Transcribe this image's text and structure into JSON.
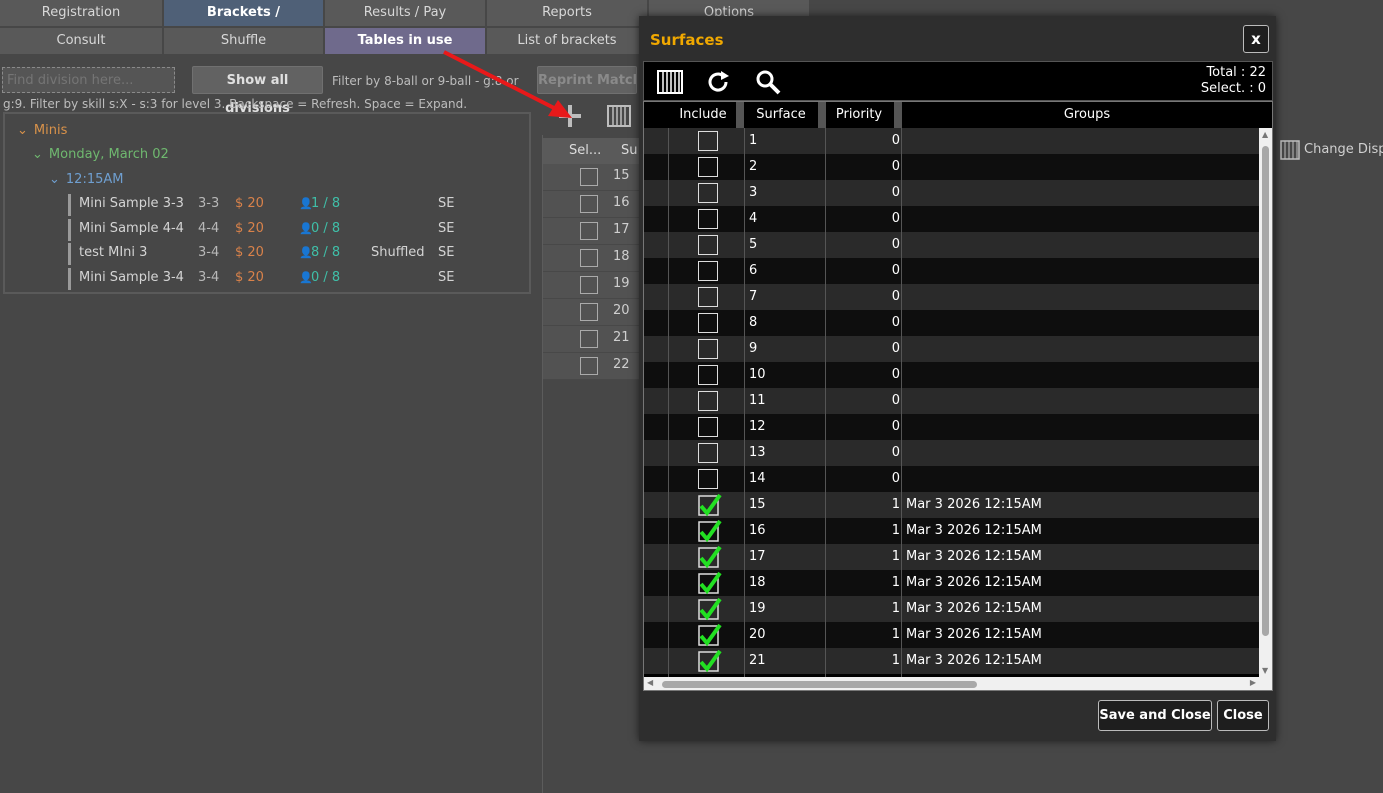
{
  "tabs_row1": [
    "Registration",
    "Brackets /",
    "Results / Pay",
    "Reports",
    "Options"
  ],
  "tabs_row2": [
    "Consult",
    "Shuffle",
    "Tables in use",
    "List of brackets"
  ],
  "filter": {
    "placeholder": "Find division here...",
    "show_all_label": "Show all divisions",
    "hint1": "Filter by 8-ball or 9-ball - g:8 or",
    "hint2": "g:9. Filter by skill s:X - s:3 for level 3. Backspace = Refresh. Space = Expand.",
    "reprint_label": "Reprint Match C"
  },
  "tree": {
    "group": "Minis",
    "date": "Monday, March 02",
    "time": "12:15AM",
    "divisions": [
      {
        "name": "Mini Sample 3-3",
        "level": "3-3",
        "fee": "$ 20",
        "players": "1 / 8",
        "status": "",
        "type": "SE"
      },
      {
        "name": "Mini Sample 4-4",
        "level": "4-4",
        "fee": "$ 20",
        "players": "0 / 8",
        "status": "",
        "type": "SE"
      },
      {
        "name": "test MIni 3",
        "level": "3-4",
        "fee": "$ 20",
        "players": "8 / 8",
        "status": "Shuffled",
        "type": "SE"
      },
      {
        "name": "Mini Sample 3-4",
        "level": "3-4",
        "fee": "$ 20",
        "players": "0 / 8",
        "status": "",
        "type": "SE"
      }
    ]
  },
  "background_table": {
    "headers": [
      "Sel...",
      "Su"
    ],
    "rows": [
      "15",
      "16",
      "17",
      "18",
      "19",
      "20",
      "21",
      "22"
    ]
  },
  "change_display_label": "Change Disp",
  "modal": {
    "title": "Surfaces",
    "close_x": "x",
    "total_label": "Total : 22",
    "select_label": "Select. : 0",
    "columns": [
      "Include",
      "Surface",
      "Priority",
      "Groups"
    ],
    "rows": [
      {
        "include": false,
        "surface": "1",
        "priority": "0",
        "groups": ""
      },
      {
        "include": false,
        "surface": "2",
        "priority": "0",
        "groups": ""
      },
      {
        "include": false,
        "surface": "3",
        "priority": "0",
        "groups": ""
      },
      {
        "include": false,
        "surface": "4",
        "priority": "0",
        "groups": ""
      },
      {
        "include": false,
        "surface": "5",
        "priority": "0",
        "groups": ""
      },
      {
        "include": false,
        "surface": "6",
        "priority": "0",
        "groups": ""
      },
      {
        "include": false,
        "surface": "7",
        "priority": "0",
        "groups": ""
      },
      {
        "include": false,
        "surface": "8",
        "priority": "0",
        "groups": ""
      },
      {
        "include": false,
        "surface": "9",
        "priority": "0",
        "groups": ""
      },
      {
        "include": false,
        "surface": "10",
        "priority": "0",
        "groups": ""
      },
      {
        "include": false,
        "surface": "11",
        "priority": "0",
        "groups": ""
      },
      {
        "include": false,
        "surface": "12",
        "priority": "0",
        "groups": ""
      },
      {
        "include": false,
        "surface": "13",
        "priority": "0",
        "groups": ""
      },
      {
        "include": false,
        "surface": "14",
        "priority": "0",
        "groups": ""
      },
      {
        "include": true,
        "surface": "15",
        "priority": "1",
        "groups": "Mar 3 2026 12:15AM"
      },
      {
        "include": true,
        "surface": "16",
        "priority": "1",
        "groups": "Mar 3 2026 12:15AM"
      },
      {
        "include": true,
        "surface": "17",
        "priority": "1",
        "groups": "Mar 3 2026 12:15AM"
      },
      {
        "include": true,
        "surface": "18",
        "priority": "1",
        "groups": "Mar 3 2026 12:15AM"
      },
      {
        "include": true,
        "surface": "19",
        "priority": "1",
        "groups": "Mar 3 2026 12:15AM"
      },
      {
        "include": true,
        "surface": "20",
        "priority": "1",
        "groups": "Mar 3 2026 12:15AM"
      },
      {
        "include": true,
        "surface": "21",
        "priority": "1",
        "groups": "Mar 3 2026 12:15AM"
      }
    ],
    "save_close_label": "Save and Close",
    "close_label": "Close"
  },
  "colors": {
    "accent_orange": "#f0a800",
    "group_orange": "#d9924a",
    "date_green": "#6fb86f",
    "time_blue": "#6f9fd0",
    "fee_orange": "#d9824a",
    "players_teal": "#3fbfa8",
    "check_green": "#22e022"
  }
}
